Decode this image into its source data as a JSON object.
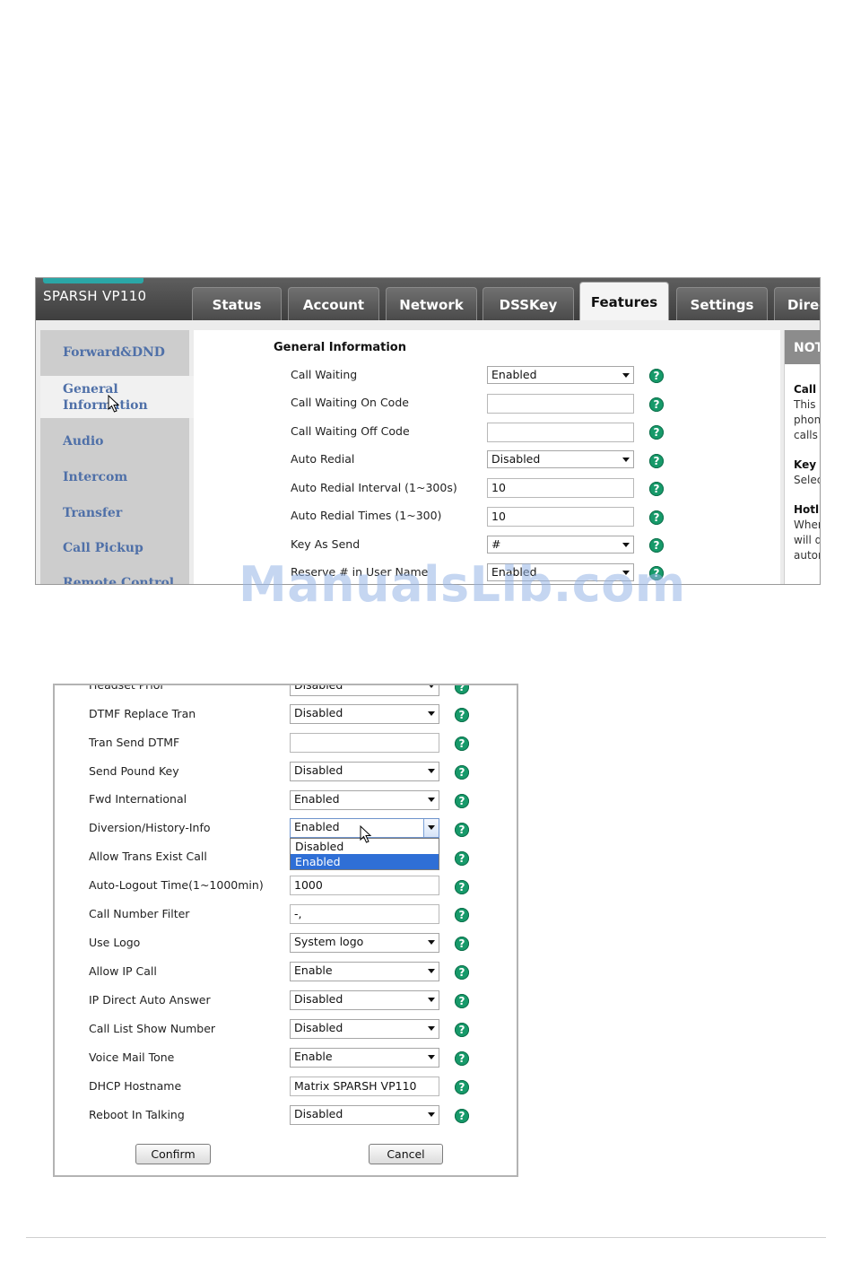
{
  "screen1": {
    "product": "SPARSH VP110",
    "tabs": [
      "Status",
      "Account",
      "Network",
      "DSSKey",
      "Features",
      "Settings",
      "Direc"
    ],
    "active_tab": "Features",
    "sidebar": [
      "Forward&DND",
      "General Information",
      "Audio",
      "Intercom",
      "Transfer",
      "Call Pickup",
      "Remote Control"
    ],
    "section_title": "General Information",
    "rows": [
      {
        "label": "Call Waiting",
        "value": "Enabled",
        "type": "select"
      },
      {
        "label": "Call Waiting On Code",
        "value": "",
        "type": "input"
      },
      {
        "label": "Call Waiting Off Code",
        "value": "",
        "type": "input"
      },
      {
        "label": "Auto Redial",
        "value": "Disabled",
        "type": "select"
      },
      {
        "label": "Auto Redial Interval (1~300s)",
        "value": "10",
        "type": "input"
      },
      {
        "label": "Auto Redial Times (1~300)",
        "value": "10",
        "type": "input"
      },
      {
        "label": "Key As Send",
        "value": "#",
        "type": "select"
      },
      {
        "label": "Reserve # in User Name",
        "value": "Enabled",
        "type": "select"
      }
    ],
    "help_glyph": "?",
    "note": {
      "head": "NOT",
      "lines": [
        {
          "text": "Call W",
          "bold": true
        },
        {
          "text": "This c",
          "bold": false
        },
        {
          "text": "phone",
          "bold": false
        },
        {
          "text": "calls o",
          "bold": false
        },
        {
          "text": "Key A",
          "bold": true
        },
        {
          "text": "Selec",
          "bold": false
        },
        {
          "text": "Hotli",
          "bold": true
        },
        {
          "text": "When",
          "bold": false
        },
        {
          "text": "will di",
          "bold": false
        },
        {
          "text": "autom",
          "bold": false
        }
      ]
    }
  },
  "watermark": "ManualsLib.com",
  "screen2": {
    "rows": [
      {
        "label": "Headset Prior",
        "value": "Disabled",
        "type": "select"
      },
      {
        "label": "DTMF Replace Tran",
        "value": "Disabled",
        "type": "select"
      },
      {
        "label": "Tran Send DTMF",
        "value": "",
        "type": "input"
      },
      {
        "label": "Send Pound Key",
        "value": "Disabled",
        "type": "select"
      },
      {
        "label": "Fwd International",
        "value": "Enabled",
        "type": "select"
      },
      {
        "label": "Diversion/History-Info",
        "value": "Enabled",
        "type": "open-select"
      },
      {
        "label": "Allow Trans Exist Call",
        "value": "",
        "type": "covered"
      },
      {
        "label": "Auto-Logout Time(1~1000min)",
        "value": "1000",
        "type": "input"
      },
      {
        "label": "Call Number Filter",
        "value": "-,",
        "type": "input"
      },
      {
        "label": "Use Logo",
        "value": "System logo",
        "type": "select"
      },
      {
        "label": "Allow IP Call",
        "value": "Enable",
        "type": "select"
      },
      {
        "label": "IP Direct Auto Answer",
        "value": "Disabled",
        "type": "select"
      },
      {
        "label": "Call List Show Number",
        "value": "Disabled",
        "type": "select"
      },
      {
        "label": "Voice Mail Tone",
        "value": "Enable",
        "type": "select"
      },
      {
        "label": "DHCP Hostname",
        "value": "Matrix SPARSH VP110",
        "type": "input"
      },
      {
        "label": "Reboot In Talking",
        "value": "Disabled",
        "type": "select"
      }
    ],
    "dropdown_options": [
      "Disabled",
      "Enabled"
    ],
    "dropdown_selected": "Enabled",
    "confirm_label": "Confirm",
    "cancel_label": "Cancel"
  },
  "colors": {
    "help": "#179a6a",
    "nav_text": "#4f70a8",
    "highlight": "#2f6fd6"
  }
}
